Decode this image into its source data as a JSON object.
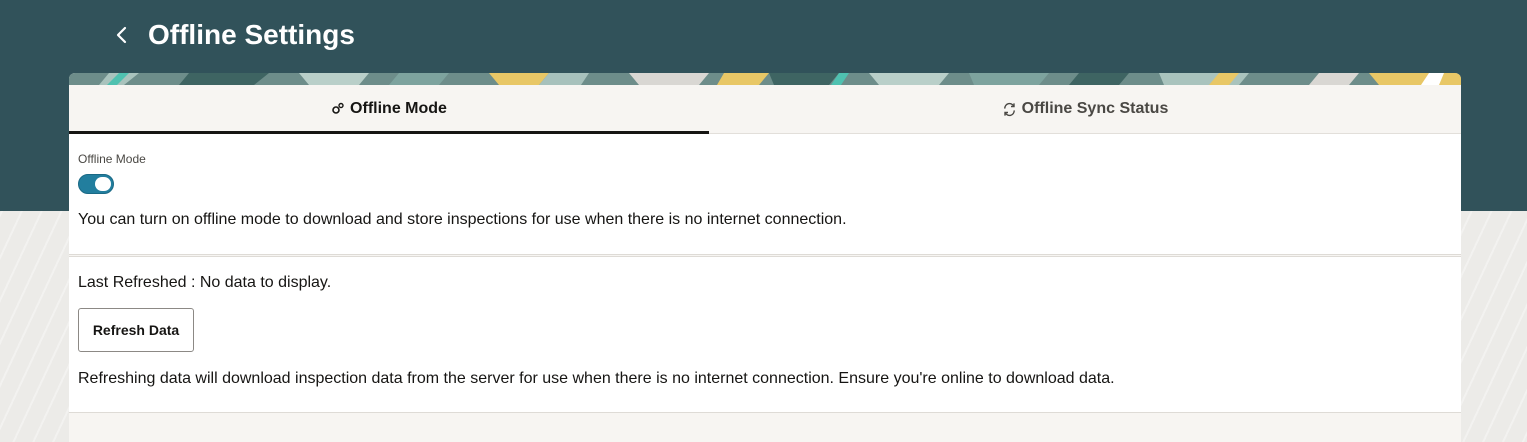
{
  "header": {
    "title": "Offline Settings",
    "back_icon": "chevron-left-icon"
  },
  "tabs": [
    {
      "label": "Offline Mode",
      "icon": "gears-icon",
      "selected": true
    },
    {
      "label": "Offline Sync Status",
      "icon": "sync-icon",
      "selected": false
    }
  ],
  "offline_mode": {
    "label": "Offline Mode",
    "enabled": true,
    "description": "You can turn on offline mode to download and store inspections for use when there is no internet connection."
  },
  "refresh": {
    "last_refreshed": "Last Refreshed : No data to display.",
    "button_label": "Refresh Data",
    "description": "Refreshing data will download inspection data from the server for use when there is no internet connection. Ensure you're online to download data."
  },
  "colors": {
    "header_bg": "#31525a",
    "toggle_on": "#227e9e",
    "banner_yellow": "#e8c766",
    "banner_teal": "#4fc1b0"
  }
}
